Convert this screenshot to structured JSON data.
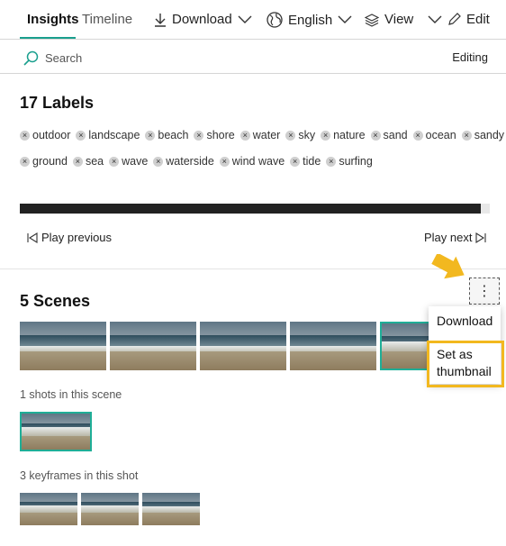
{
  "tabs": [
    {
      "label": "Insights",
      "active": true
    },
    {
      "label": "Timeline",
      "active": false
    }
  ],
  "toolbar": {
    "download_label": "Download",
    "language_label": "English",
    "view_label": "View",
    "edit_label": "Edit"
  },
  "search": {
    "placeholder": "Search",
    "editing_label": "Editing"
  },
  "labels_section": {
    "title": "17 Labels",
    "row1": [
      "outdoor",
      "landscape",
      "beach",
      "shore",
      "water",
      "sky",
      "nature",
      "sand",
      "ocean",
      "sandy"
    ],
    "row2": [
      "ground",
      "sea",
      "wave",
      "waterside",
      "wind wave",
      "tide",
      "surfing"
    ],
    "progress_fraction": 0.98,
    "play_previous": "Play previous",
    "play_next": "Play next"
  },
  "scenes_section": {
    "title": "5 Scenes",
    "scene_count": 5,
    "shots_caption": "1 shots in this scene",
    "keyframes_caption": "3 keyframes in this shot"
  },
  "context_menu": {
    "more_glyph": "⋮",
    "download": "Download",
    "set_as_thumbnail_line1": "Set as",
    "set_as_thumbnail_line2": "thumbnail"
  },
  "colors": {
    "accent": "#1a9f8e",
    "highlight": "#f2b81f"
  }
}
